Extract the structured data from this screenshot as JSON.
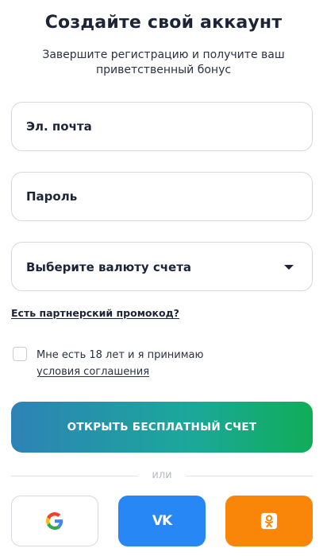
{
  "header": {
    "title": "Создайте свой аккаунт",
    "subtitle": "Завершите регистрацию и получите ваш приветственный бонус"
  },
  "form": {
    "email_placeholder": "Эл. почта",
    "password_placeholder": "Пароль",
    "currency_select_label": "Выберите валюту счета",
    "promo_link": "Есть партнерский промокод?",
    "agreement_text": "Мне есть 18 лет и я принимаю",
    "agreement_link": "условия соглашения",
    "agreement_checked": false,
    "submit_label": "ОТКРЫТЬ БЕСПЛАТНЫЙ СЧЕТ"
  },
  "social": {
    "divider_text": "или",
    "google_icon": "google-icon",
    "vk_icon": "vk-icon",
    "vk_text": "VK",
    "ok_icon": "odnoklassniki-icon"
  },
  "colors": {
    "cta_gradient_start": "#2e82b6",
    "cta_gradient_end": "#10ad57",
    "vk_blue": "#2787f5",
    "ok_orange": "#f98509"
  }
}
